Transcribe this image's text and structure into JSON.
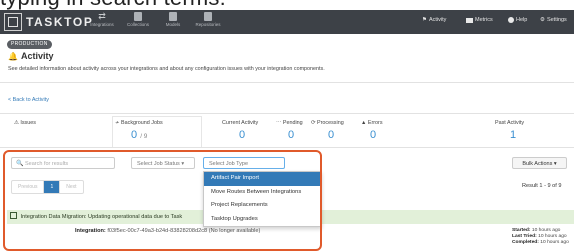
{
  "caption": "typing in search terms:",
  "nav": {
    "logo": "TASKTOP",
    "items": [
      "Integrations",
      "Collections",
      "Models",
      "Repositories"
    ],
    "right": [
      "Activity",
      "Metrics",
      "Help",
      "Settings"
    ]
  },
  "header": {
    "badge": "PRODUCTION",
    "title": "Activity",
    "subtitle": "See detailed information about activity across your integrations and about any configuration issues with your integration components.",
    "back_link": "< Back to Activity"
  },
  "stats": {
    "issues": {
      "label": "Issues",
      "value": ""
    },
    "background_jobs": {
      "label": "Background Jobs",
      "value": "0",
      "total": "/ 9"
    },
    "current_activity": {
      "label": "Current Activity",
      "value": "0"
    },
    "pending": {
      "label": "Pending",
      "value": "0"
    },
    "processing": {
      "label": "Processing",
      "value": "0"
    },
    "errors": {
      "label": "Errors",
      "value": "0"
    },
    "past_activity": {
      "label": "Past Activity",
      "value": "1"
    }
  },
  "toolbar": {
    "search_placeholder": "Search for results",
    "job_status": "Select Job Status",
    "job_type_placeholder": "Select Job Type",
    "bulk_actions": "Bulk Actions"
  },
  "job_type_options": [
    "Artifact Pair Import",
    "Move Routes Between Integrations",
    "Project Replacements",
    "Tasktop Upgrades"
  ],
  "pager": {
    "previous": "Previous",
    "current": "1",
    "next": "Next"
  },
  "result_count": "Result 1 - 9 of 9",
  "job": {
    "title": "Integration Data Migration: Updating operational data due to Task",
    "integration_label": "Integration:",
    "integration_value": "f03f5ec-00c7-49a3-b24d-83828208d2c8 (No longer available)",
    "started": {
      "label": "Started:",
      "value": "10 hours ago"
    },
    "last_tried": {
      "label": "Last Tried:",
      "value": "10 hours ago"
    },
    "completed": {
      "label": "Completed:",
      "value": "10 hours ago"
    }
  },
  "colors": {
    "accent": "#337ab7",
    "highlight": "#e05a2b",
    "nav_bg": "#3d4147",
    "success_bg": "#e2f0d9"
  }
}
